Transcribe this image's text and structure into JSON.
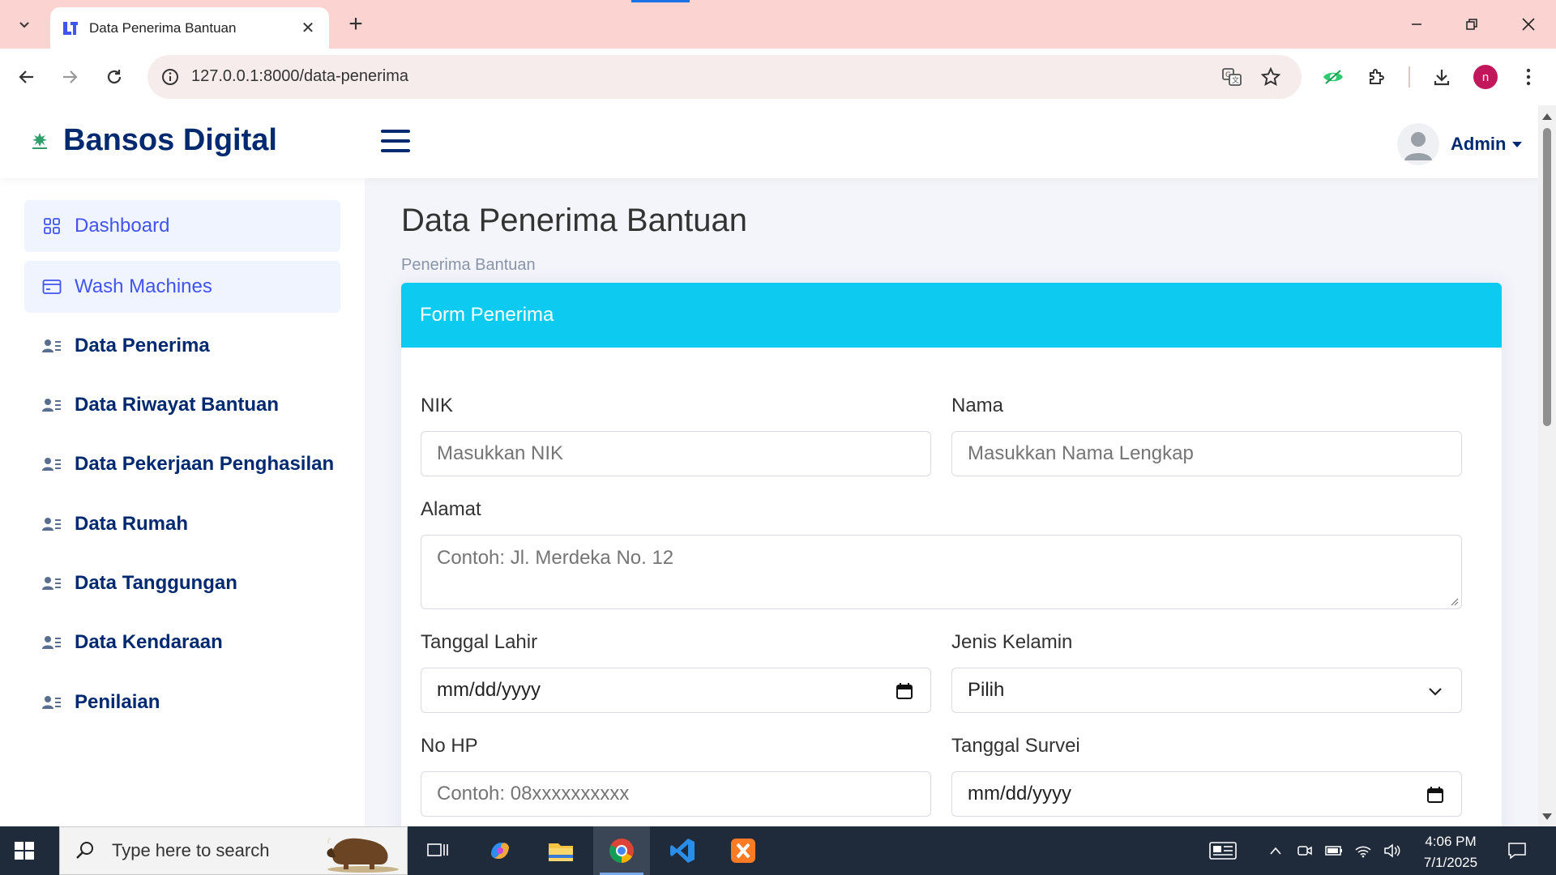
{
  "browser": {
    "tab_title": "Data Penerima Bantuan",
    "url": "127.0.0.1:8000/data-penerima",
    "profile_initial": "n"
  },
  "topnav": {
    "brand": "Bansos Digital",
    "user": "Admin"
  },
  "sidebar": {
    "items": [
      {
        "label": "Dashboard",
        "icon": "grid-icon",
        "active": true
      },
      {
        "label": "Wash Machines",
        "icon": "card-icon",
        "active": true
      },
      {
        "label": "Data Penerima",
        "icon": "person-lines-icon"
      },
      {
        "label": "Data Riwayat Bantuan",
        "icon": "person-lines-icon"
      },
      {
        "label": "Data Pekerjaan Penghasilan",
        "icon": "person-lines-icon"
      },
      {
        "label": "Data Rumah",
        "icon": "person-lines-icon"
      },
      {
        "label": "Data Tanggungan",
        "icon": "person-lines-icon"
      },
      {
        "label": "Data Kendaraan",
        "icon": "person-lines-icon"
      },
      {
        "label": "Penilaian",
        "icon": "person-lines-icon"
      }
    ]
  },
  "main": {
    "title": "Data Penerima Bantuan",
    "breadcrumb": "Penerima Bantuan",
    "card_title": "Form Penerima",
    "form": {
      "nik_label": "NIK",
      "nik_placeholder": "Masukkan NIK",
      "nama_label": "Nama",
      "nama_placeholder": "Masukkan Nama Lengkap",
      "alamat_label": "Alamat",
      "alamat_placeholder": "Contoh: Jl. Merdeka No. 12",
      "tgl_lahir_label": "Tanggal Lahir",
      "tgl_lahir_value": "mm/dd/yyyy",
      "jk_label": "Jenis Kelamin",
      "jk_value": "Pilih",
      "hp_label": "No HP",
      "hp_placeholder": "Contoh: 08xxxxxxxxxx",
      "tgl_survei_label": "Tanggal Survei",
      "tgl_survei_value": "mm/dd/yyyy"
    }
  },
  "taskbar": {
    "search_placeholder": "Type here to search",
    "time": "4:06 PM",
    "date": "7/1/2025"
  },
  "colors": {
    "brand": "#012970",
    "accent": "#4154f1",
    "card_header": "#0dcaf0"
  }
}
